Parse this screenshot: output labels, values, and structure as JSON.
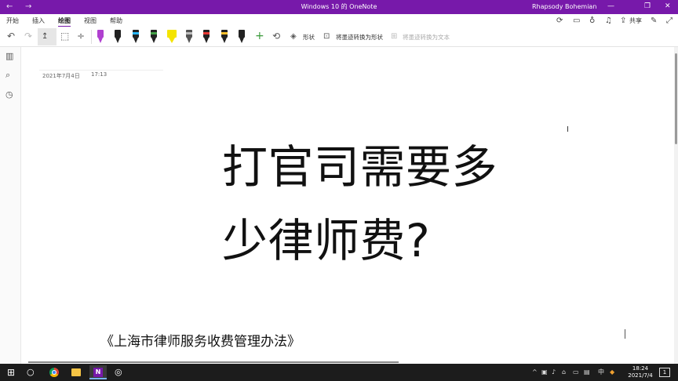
{
  "titlebar": {
    "title": "Windows 10 的 OneNote",
    "user": "Rhapsody Bohemian",
    "back_icon": "←",
    "forward_icon": "→",
    "minimize_icon": "—",
    "restore_icon": "❐",
    "close_icon": "✕",
    "accent": "#7719aa"
  },
  "ribbon": {
    "tabs": [
      "开始",
      "插入",
      "绘图",
      "视图",
      "帮助"
    ],
    "active_tab": "绘图",
    "share_label": "共享"
  },
  "toolbar": {
    "undo_icon": "↶",
    "redo_icon": "↷",
    "lasso_icon": "⬚",
    "add_space_icon": "÷",
    "add_pen_icon": "+",
    "ruler_icon": "⟲",
    "shapes_label": "形状",
    "ink_to_shape_label": "将墨迹转换为形状",
    "ink_to_text_label": "将墨迹转换为文本",
    "pens": [
      {
        "name": "highlighter-purple",
        "color": "#b040d0"
      },
      {
        "name": "pen-black-1",
        "color": "#111111"
      },
      {
        "name": "pen-cyan",
        "color": "#29b6f6"
      },
      {
        "name": "pen-green",
        "color": "#43a047"
      },
      {
        "name": "highlighter-yellow",
        "color": "#f4e400"
      },
      {
        "name": "pen-gray",
        "color": "#777777"
      },
      {
        "name": "pen-red",
        "color": "#e53935"
      },
      {
        "name": "pen-yellow",
        "color": "#fbc02d"
      },
      {
        "name": "pen-black-2",
        "color": "#111111"
      }
    ]
  },
  "page": {
    "date": "2021年7月4日",
    "time": "17:13",
    "title_line1": "打官司需要多",
    "title_line2": "少律师费?",
    "subtitle": "《上海市律师服务收费管理办法》"
  },
  "taskbar": {
    "time": "18:24",
    "date": "2021/7/4",
    "ime": "中",
    "notification_count": "1"
  }
}
